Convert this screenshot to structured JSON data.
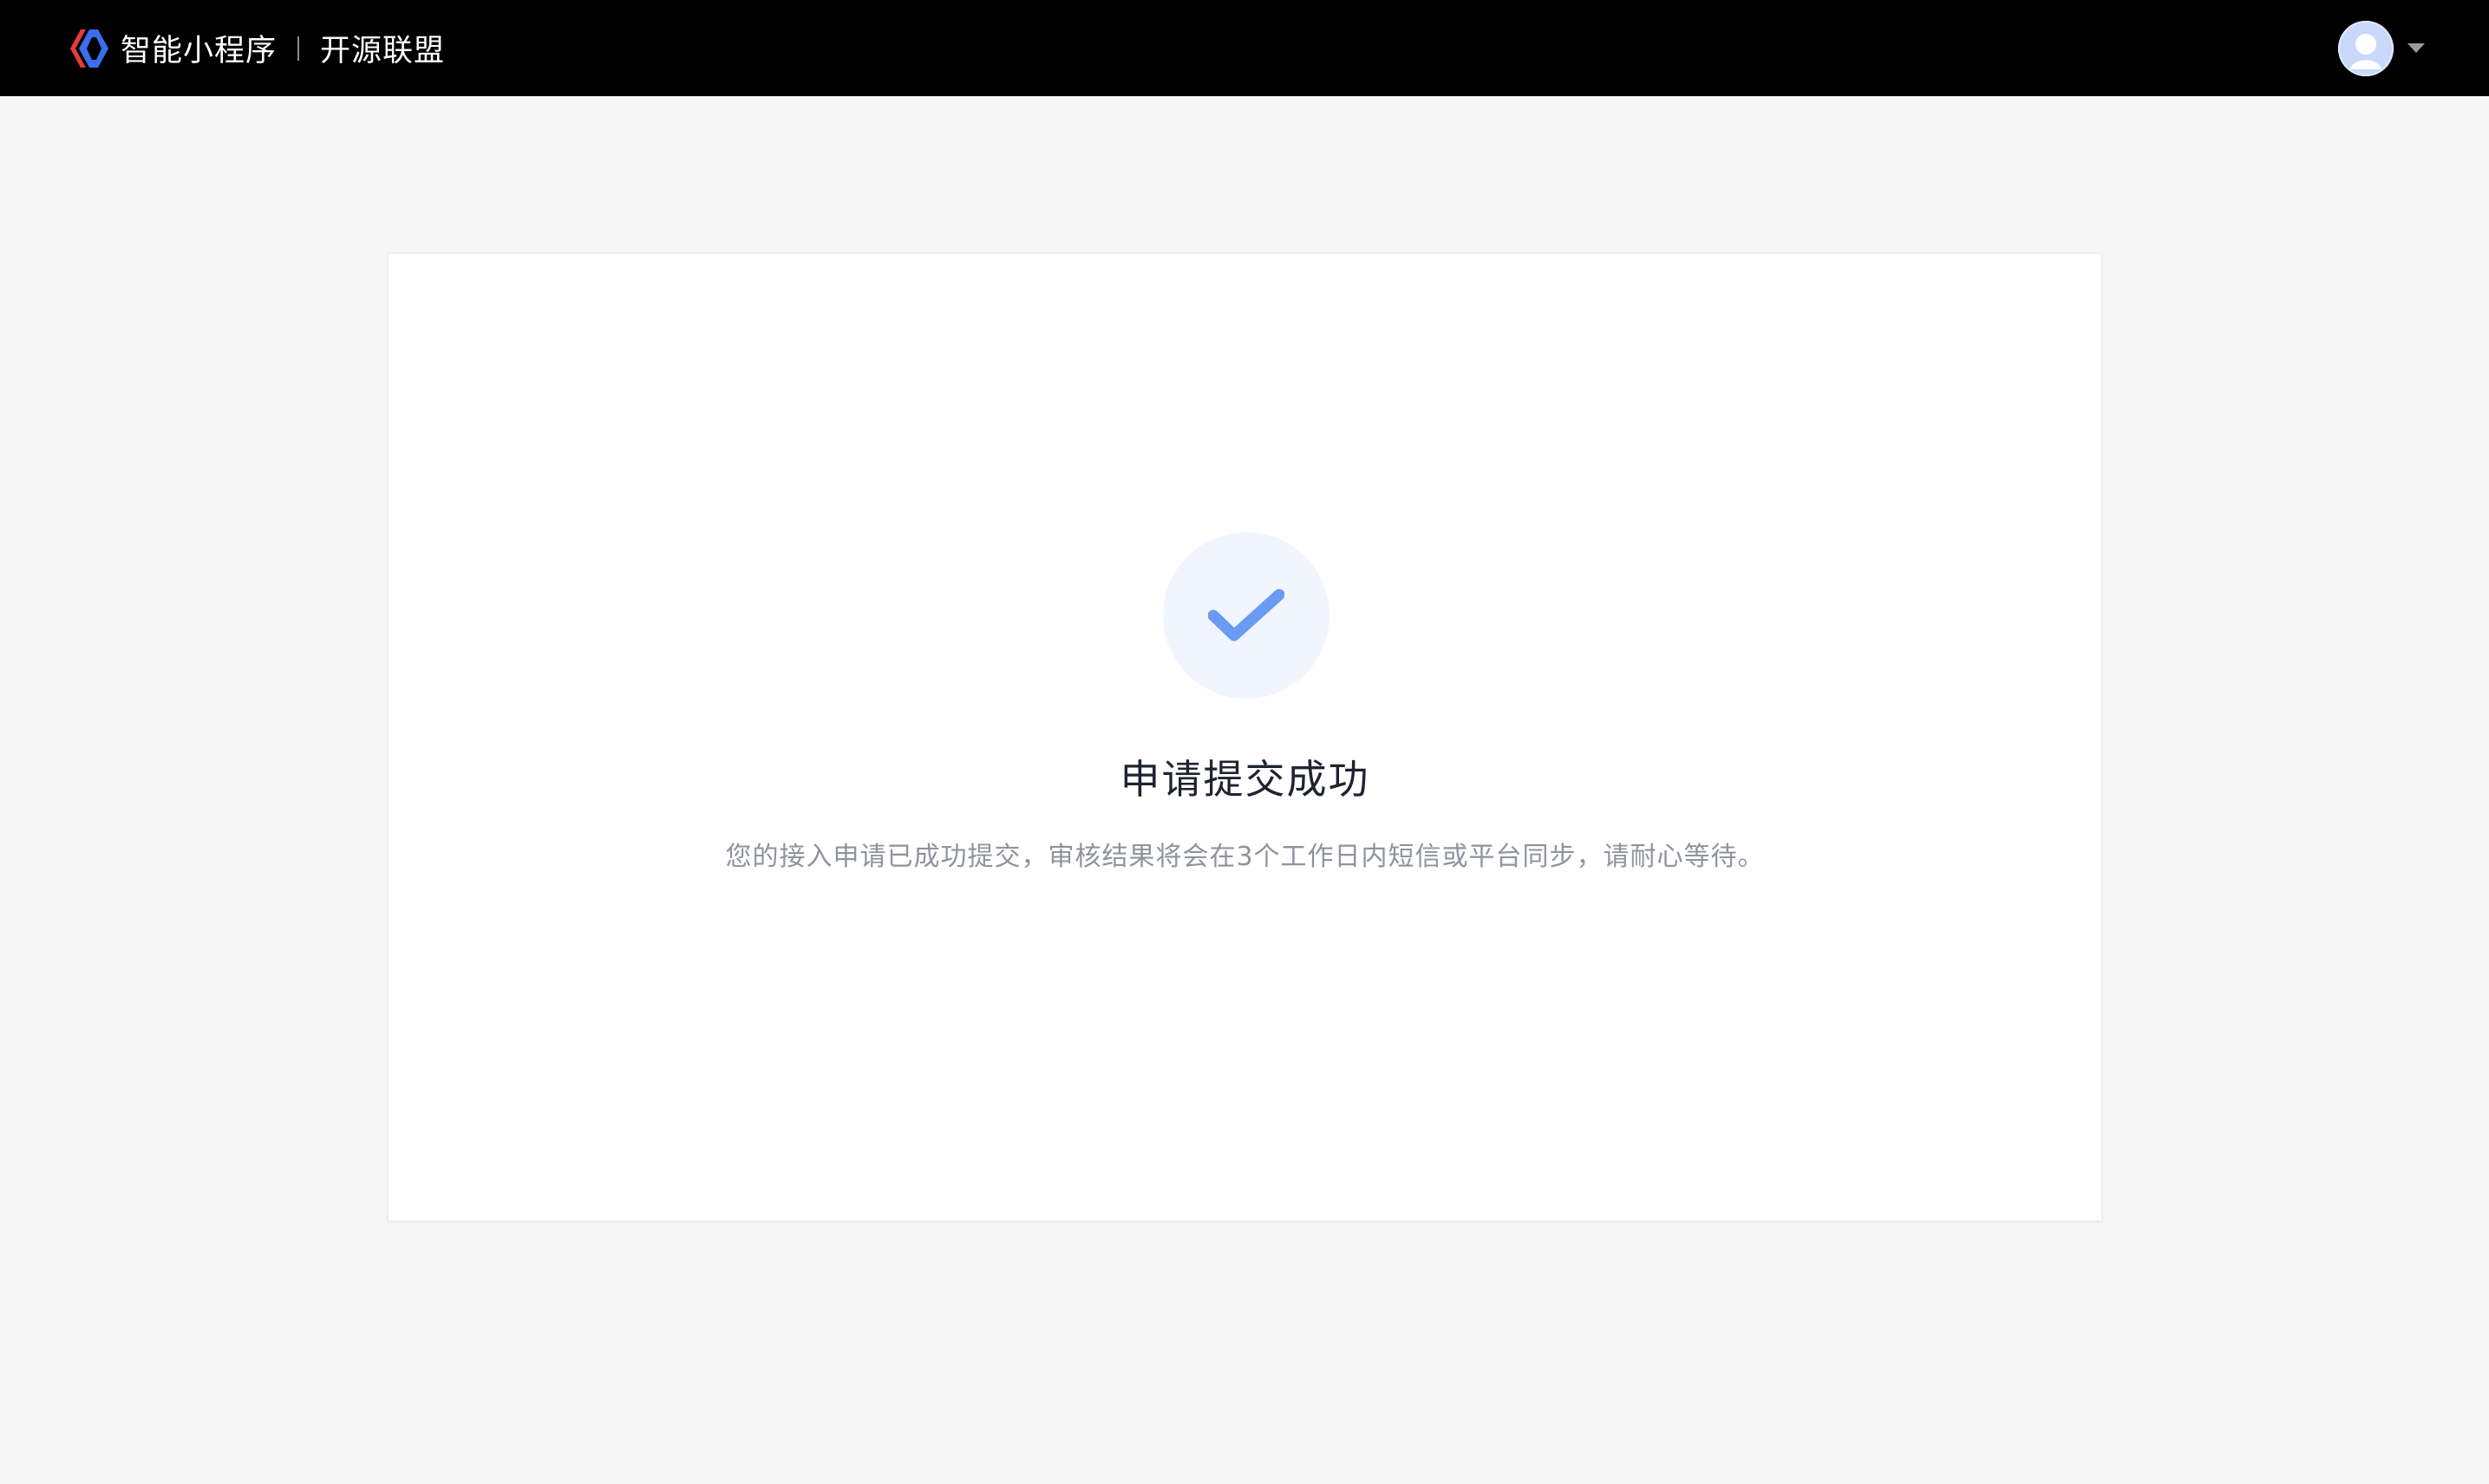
{
  "header": {
    "brand_name": "智能小程序",
    "brand_sub": "开源联盟",
    "logo_icon": "swan-logo-icon",
    "avatar_icon": "user-avatar-icon",
    "dropdown_icon": "caret-down-icon"
  },
  "result": {
    "status_icon": "check-icon",
    "title": "申请提交成功",
    "description": "您的接入申请已成功提交，审核结果将会在3个工作日内短信或平台同步，请耐心等待。"
  },
  "colors": {
    "header_bg": "#000000",
    "page_bg": "#f7f7f7",
    "card_bg": "#ffffff",
    "check_color": "#6a9af3",
    "check_circle_bg": "#f1f5fe",
    "logo_red": "#e53b3b",
    "logo_blue": "#3b6df0"
  }
}
